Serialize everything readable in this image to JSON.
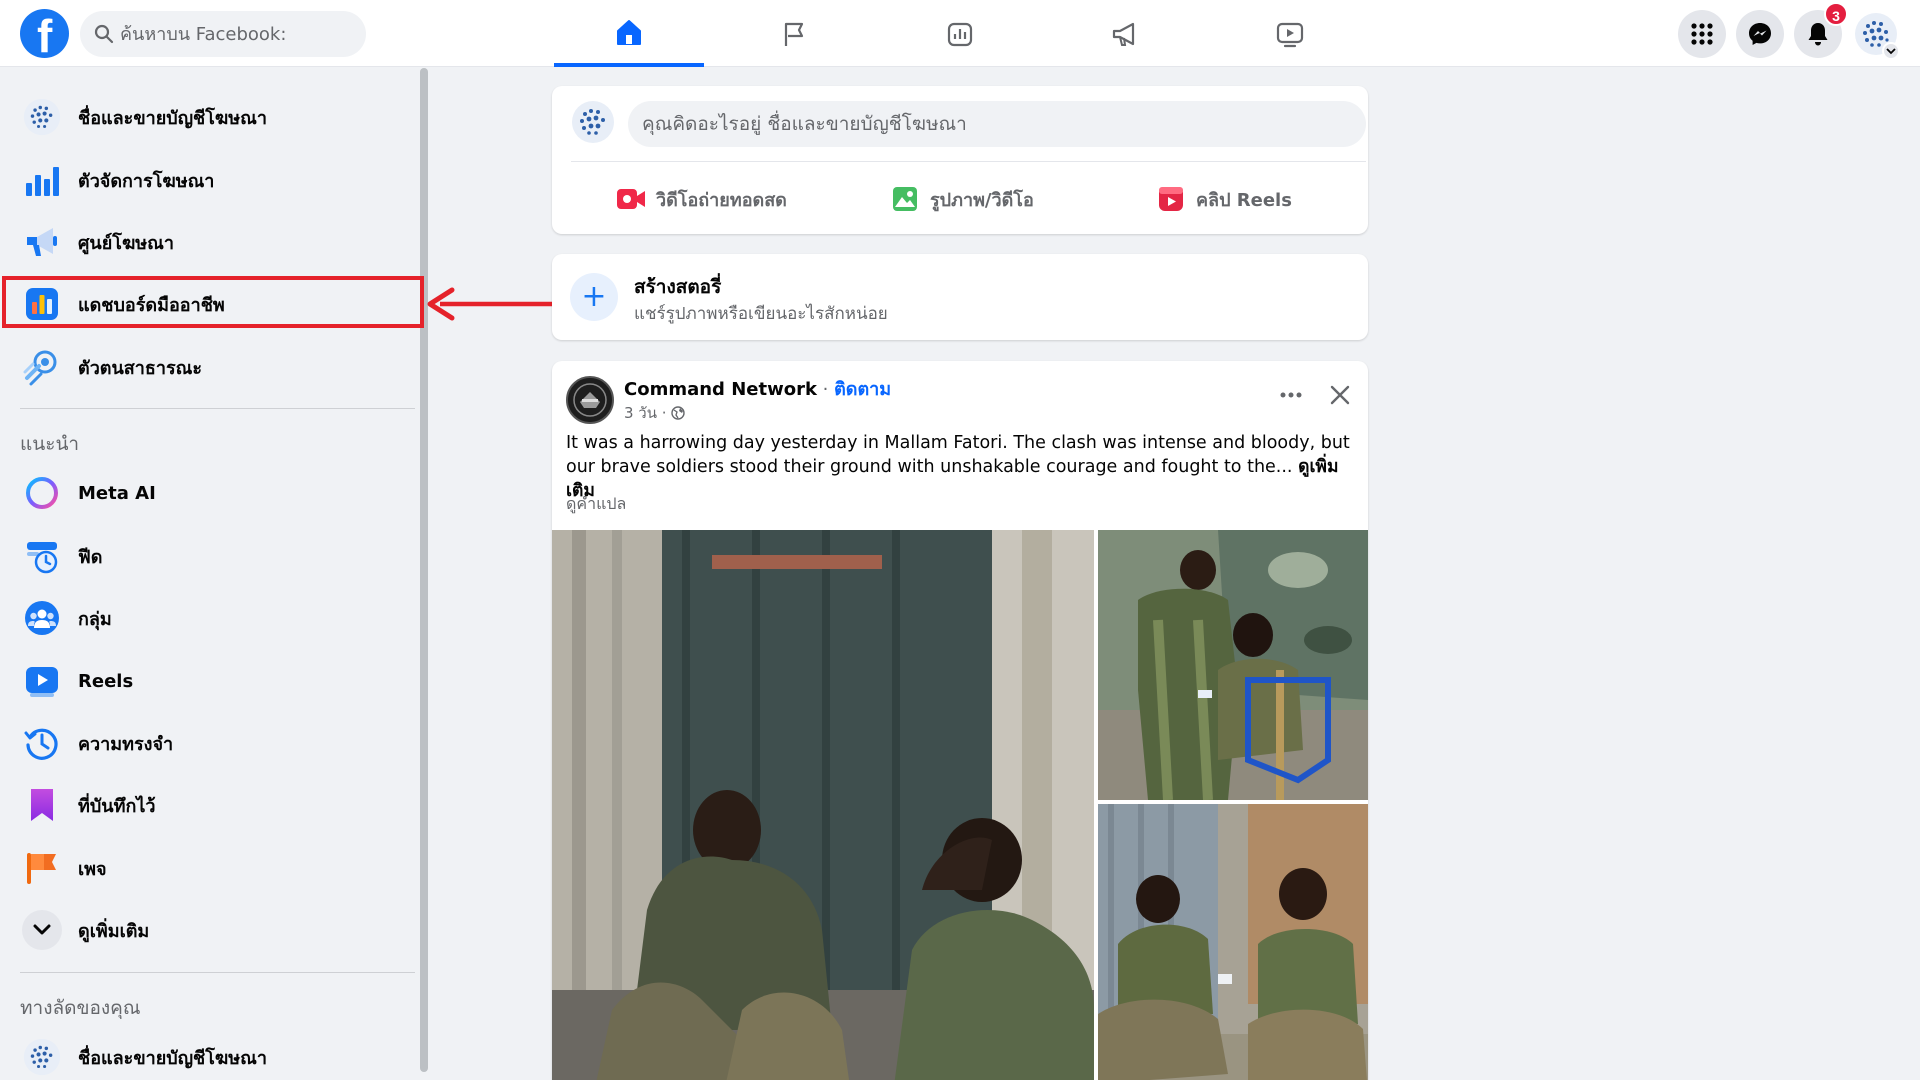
{
  "topbar": {
    "logo": "f",
    "search_placeholder": "ค้นหาบน Facebook:",
    "tabs": [
      {
        "name": "home-tab",
        "icon": "home-icon",
        "active": true
      },
      {
        "name": "pages-tab",
        "icon": "flag-icon",
        "active": false
      },
      {
        "name": "ads-insights-tab",
        "icon": "chart-icon",
        "active": false
      },
      {
        "name": "ads-tab",
        "icon": "megaphone-icon",
        "active": false
      },
      {
        "name": "video-tab",
        "icon": "video-icon",
        "active": false
      }
    ],
    "notifications_count": "3"
  },
  "sidebar": {
    "items": [
      {
        "label": "ชื่อและขายบัญชีโฆษณา",
        "icon": "profile-avatar-icon"
      },
      {
        "label": "ตัวจัดการโฆษณา",
        "icon": "bar-chart-icon"
      },
      {
        "label": "ศูนย์โฆษณา",
        "icon": "megaphone-icon"
      },
      {
        "label": "แดชบอร์ดมืออาชีพ",
        "icon": "dashboard-icon"
      },
      {
        "label": "ตัวตนสาธารณะ",
        "icon": "public-presence-icon"
      }
    ],
    "suggested_heading": "แนะนำ",
    "suggested": [
      {
        "label": "Meta AI",
        "icon": "meta-ai-icon"
      },
      {
        "label": "ฟีด",
        "icon": "feed-icon"
      },
      {
        "label": "กลุ่ม",
        "icon": "groups-icon"
      },
      {
        "label": "Reels",
        "icon": "reels-icon"
      },
      {
        "label": "ความทรงจำ",
        "icon": "memories-icon"
      },
      {
        "label": "ที่บันทึกไว้",
        "icon": "saved-icon"
      },
      {
        "label": "เพจ",
        "icon": "pages-flag-icon"
      },
      {
        "label": "ดูเพิ่มเติม",
        "icon": "chevron-down-icon"
      }
    ],
    "shortcuts_heading": "ทางลัดของคุณ",
    "shortcuts": [
      {
        "label": "ชื่อและขายบัญชีโฆษณา",
        "icon": "profile-avatar-icon"
      }
    ]
  },
  "composer": {
    "placeholder": "คุณคิดอะไรอยู่ ชื่อและขายบัญชีโฆษณา",
    "live_label": "วิดีโอถ่ายทอดสด",
    "photo_label": "รูปภาพ/วิดีโอ",
    "reels_label": "คลิป Reels"
  },
  "story": {
    "title": "สร้างสตอรี่",
    "subtitle": "แชร์รูปภาพหรือเขียนอะไรสักหน่อย"
  },
  "post": {
    "author": "Command Network",
    "separator": " · ",
    "follow": "ติดตาม",
    "time": "3 วัน ·",
    "text": "It was a harrowing day yesterday in Mallam Fatori. The clash was intense and bloody, but our brave soldiers stood their ground with unshakable courage and fought to the...",
    "see_more": "ดูเพิ่มเติม",
    "translate": "ดูคำแปล"
  },
  "colors": {
    "brand": "#1877f2",
    "active_tab": "#0866ff",
    "highlight": "#e5222a",
    "notification": "#e41e3f"
  }
}
